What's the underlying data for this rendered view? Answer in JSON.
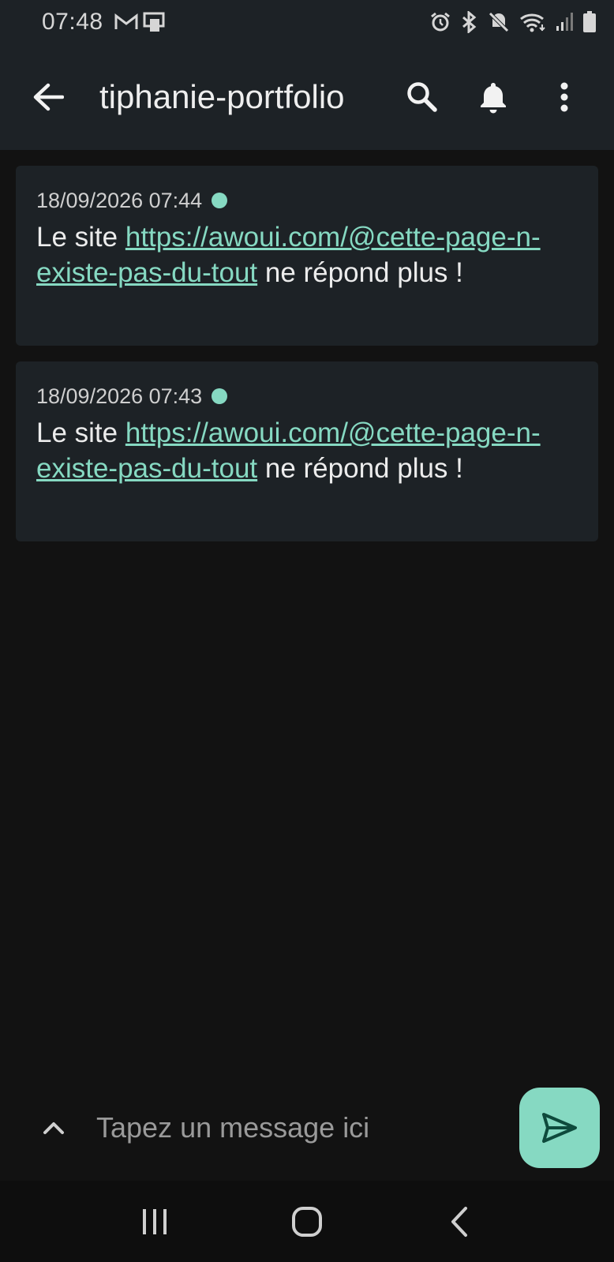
{
  "status_bar": {
    "time": "07:48",
    "left_icons": [
      "gmail-icon",
      "phone-card-icon"
    ],
    "right_icons": [
      "alarm-icon",
      "bluetooth-icon",
      "mute-icon",
      "wifi-icon",
      "signal-icon",
      "battery-icon"
    ]
  },
  "header": {
    "title": "tiphanie-portfolio",
    "back_icon": "back-arrow-icon",
    "actions": [
      "search-icon",
      "bell-icon",
      "more-vertical-icon"
    ]
  },
  "messages": [
    {
      "timestamp": "18/09/2026 07:44",
      "text_before": "Le site ",
      "link": "https://awoui.com/@cette-page-n-existe-pas-du-tout",
      "text_after": " ne répond plus !"
    },
    {
      "timestamp": "18/09/2026 07:43",
      "text_before": "Le site ",
      "link": "https://awoui.com/@cette-page-n-existe-pas-du-tout",
      "text_after": " ne répond plus !"
    }
  ],
  "composer": {
    "placeholder": "Tapez un message ici",
    "value": ""
  },
  "nav_bar": {
    "icons": [
      "recents-icon",
      "home-icon",
      "back-icon"
    ]
  },
  "colors": {
    "accent": "#86d9c2",
    "surface": "#1d2226",
    "background": "#121212"
  }
}
